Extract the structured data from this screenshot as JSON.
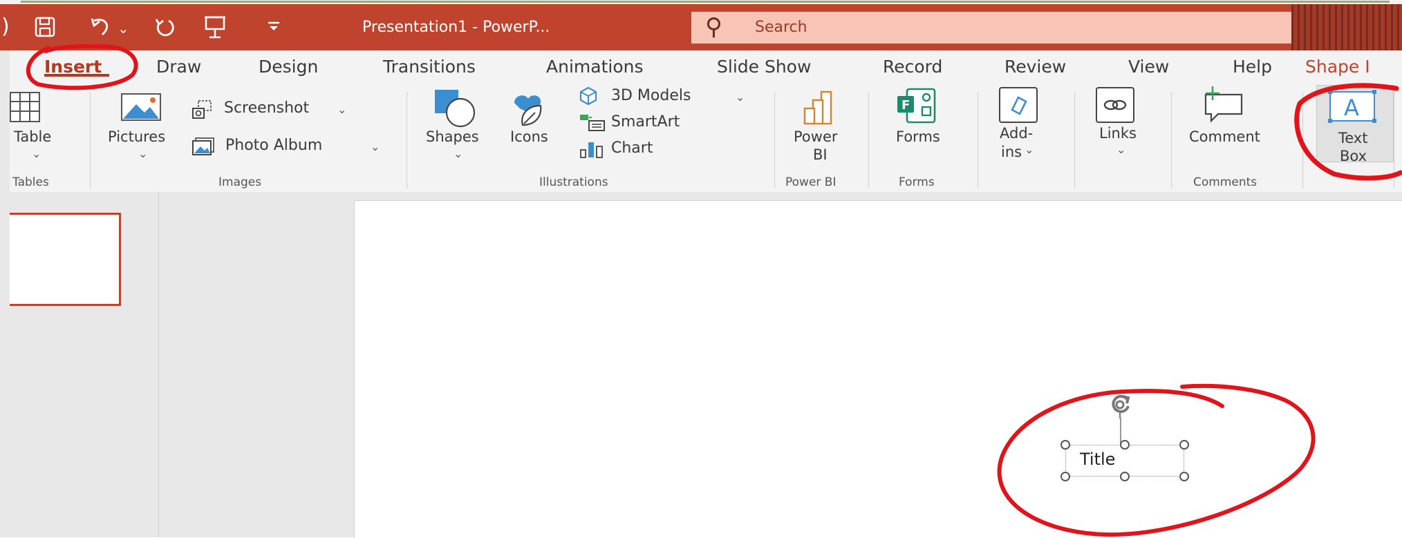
{
  "window": {
    "document_title": "Presentation1  -  PowerP...",
    "search_placeholder": "Search"
  },
  "tabs": [
    {
      "label": "Insert",
      "active": true
    },
    {
      "label": "Draw"
    },
    {
      "label": "Design"
    },
    {
      "label": "Transitions"
    },
    {
      "label": "Animations"
    },
    {
      "label": "Slide Show"
    },
    {
      "label": "Record"
    },
    {
      "label": "Review"
    },
    {
      "label": "View"
    },
    {
      "label": "Help"
    },
    {
      "label": "Shape I"
    }
  ],
  "ribbon": {
    "table": {
      "label": "Table"
    },
    "pictures": {
      "label": "Pictures"
    },
    "screenshot": {
      "label": "Screenshot"
    },
    "photo_album": {
      "label": "Photo Album"
    },
    "shapes": {
      "label": "Shapes"
    },
    "icons": {
      "label": "Icons"
    },
    "models_3d": {
      "label": "3D Models"
    },
    "smartart": {
      "label": "SmartArt"
    },
    "chart": {
      "label": "Chart"
    },
    "power_bi": {
      "line1": "Power",
      "line2": "BI"
    },
    "forms": {
      "label": "Forms"
    },
    "addins": {
      "line1": "Add-",
      "line2": "ins"
    },
    "links": {
      "label": "Links"
    },
    "comment": {
      "label": "Comment"
    },
    "textbox": {
      "line1": "Text",
      "line2": "Box"
    },
    "groups": {
      "tables": "Tables",
      "images": "Images",
      "illustrations": "Illustrations",
      "power_bi": "Power BI",
      "forms": "Forms",
      "comments": "Comments"
    }
  },
  "slide": {
    "placeholder_text": "Title"
  },
  "colors": {
    "accent": "#c0432e",
    "annotation": "#e0141b",
    "ribbon_bg": "#f3f3f3"
  }
}
